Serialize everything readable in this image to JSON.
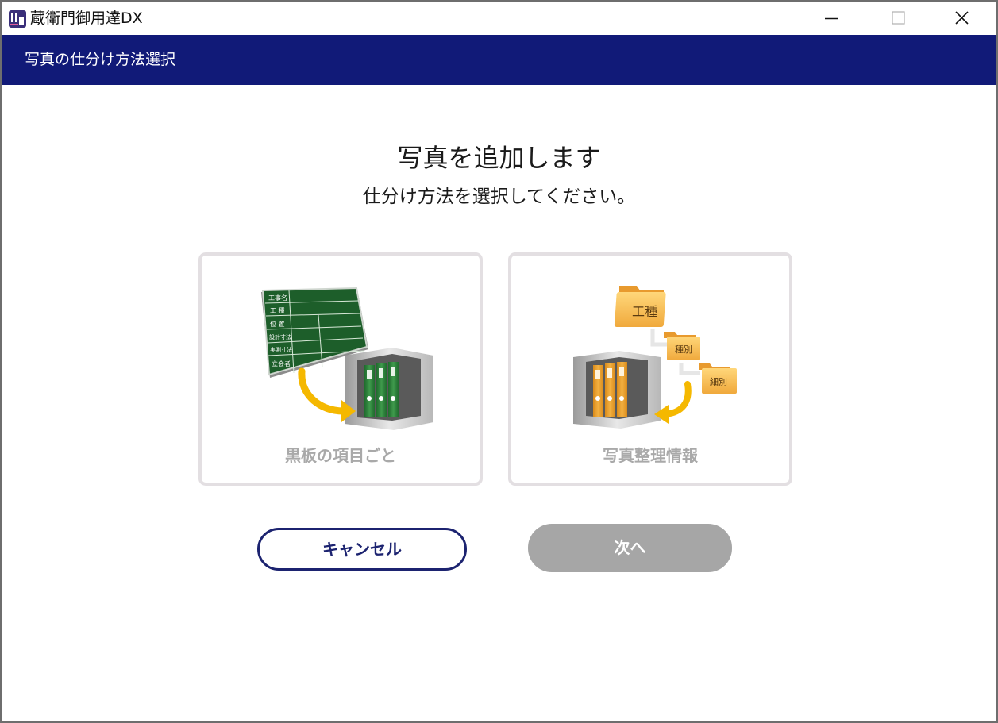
{
  "window": {
    "title": "蔵衛門御用達DX"
  },
  "header": {
    "title": "写真の仕分け方法選択"
  },
  "main": {
    "heading": "写真を追加します",
    "subheading": "仕分け方法を選択してください。",
    "options": [
      {
        "label": "黒板の項目ごと",
        "icon": "blackboard-binder-icon",
        "blackboard_rows": [
          "工事名",
          "工 種",
          "位 置",
          "設計寸法",
          "実測寸法",
          "立会者"
        ]
      },
      {
        "label": "写真整理情報",
        "icon": "folder-hierarchy-icon",
        "folders": [
          "工種",
          "種別",
          "細別"
        ]
      }
    ]
  },
  "buttons": {
    "cancel": "キャンセル",
    "next": "次へ"
  },
  "colors": {
    "header_bg": "#111a78",
    "cancel_border": "#1c2370",
    "next_disabled_bg": "#a6a6a6",
    "card_border": "#e3dfe2"
  }
}
